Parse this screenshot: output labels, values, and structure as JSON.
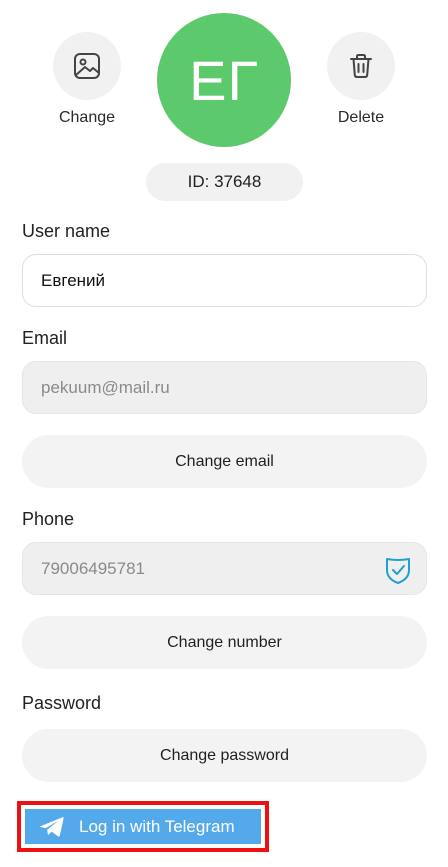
{
  "profile": {
    "change_label": "Change",
    "delete_label": "Delete",
    "avatar_initials": "ЕГ",
    "avatar_color": "#5cca6c",
    "id_text": "ID: 37648"
  },
  "form": {
    "username": {
      "label": "User name",
      "value": "Евгений"
    },
    "email": {
      "label": "Email",
      "value": "pekuum@mail.ru",
      "change_label": "Change email"
    },
    "phone": {
      "label": "Phone",
      "value": "79006495781",
      "change_label": "Change number",
      "verified_icon": "shield-check-icon"
    },
    "password": {
      "label": "Password",
      "change_label": "Change password"
    }
  },
  "telegram": {
    "label": "Log in with Telegram",
    "color": "#54a9eb",
    "highlight_color": "#ee1111",
    "icon": "telegram-plane-icon"
  }
}
